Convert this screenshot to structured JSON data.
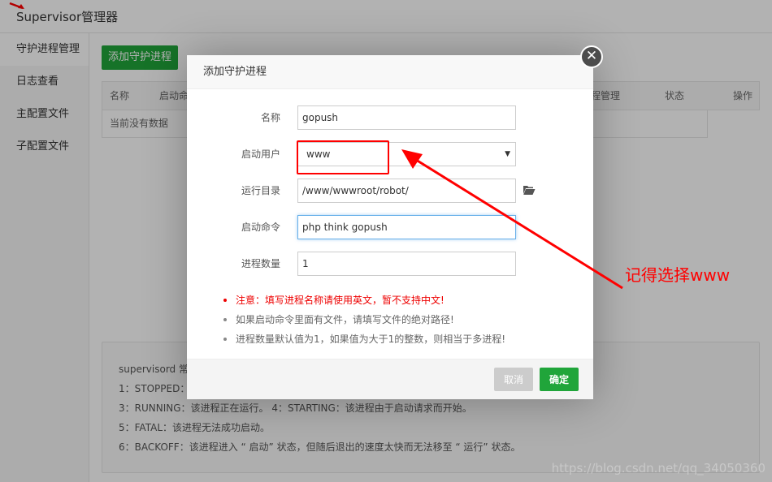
{
  "app": {
    "title": "Supervisor管理器"
  },
  "sidebar": {
    "items": [
      {
        "label": "守护进程管理"
      },
      {
        "label": "日志查看"
      },
      {
        "label": "主配置文件"
      },
      {
        "label": "子配置文件"
      }
    ]
  },
  "main": {
    "add_button": "添加守护进程",
    "table": {
      "columns": [
        "名称",
        "启动命令",
        "进程管理",
        "状态",
        "操作"
      ],
      "empty_text": "当前没有数据"
    },
    "info": {
      "lines": [
        "supervisord 常",
        "1：STOPPED：",
        "3：RUNNING：该进程正在运行。 4：STARTING：该进程由于启动请求而开始。",
        "5：FATAL：该进程无法成功启动。",
        "6：BACKOFF：该进程进入 “ 启动” 状态，但随后退出的速度太快而无法移至 “ 运行” 状态。"
      ]
    }
  },
  "dialog": {
    "title": "添加守护进程",
    "close_icon": "close-icon",
    "fields": {
      "name": {
        "label": "名称",
        "value": "gopush"
      },
      "user": {
        "label": "启动用户",
        "value": "www"
      },
      "dir": {
        "label": "运行目录",
        "value": "/www/wwwroot/robot/"
      },
      "command": {
        "label": "启动命令",
        "value": "php think gopush"
      },
      "procs": {
        "label": "进程数量",
        "value": "1"
      }
    },
    "notes": {
      "warn": "注意：填写进程名称请使用英文，暂不支持中文!",
      "n1": "如果启动命令里面有文件，请填写文件的绝对路径!",
      "n2": "进程数量默认值为1，如果值为大于1的整数，则相当于多进程!"
    },
    "buttons": {
      "cancel": "取消",
      "ok": "确定"
    }
  },
  "annotation": {
    "text": "记得选择www",
    "color": "#ff0000"
  },
  "watermark": "https://blog.csdn.net/qq_34050360",
  "colors": {
    "primary": "#20a53a",
    "annotation": "#ff0000"
  }
}
